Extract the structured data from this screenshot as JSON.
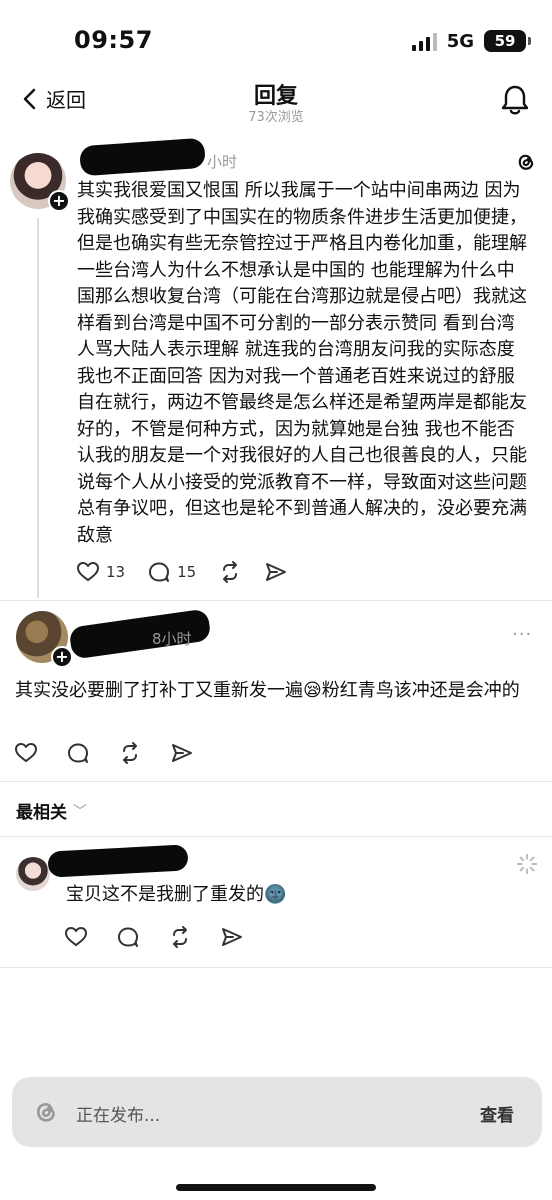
{
  "status": {
    "time": "09:57",
    "network": "5G",
    "battery": "59"
  },
  "nav": {
    "back_label": "返回",
    "title": "回复",
    "views": "73次浏览"
  },
  "post1": {
    "time_suffix": "小时",
    "text": "其实我很爱国又恨国 所以我属于一个站中间串两边 因为我确实感受到了中国实在的物质条件进步生活更加便捷，但是也确实有些无奈管控过于严格且内卷化加重，能理解一些台湾人为什么不想承认是中国的 也能理解为什么中国那么想收复台湾（可能在台湾那边就是侵占吧）我就这样看到台湾是中国不可分割的一部分表示赞同 看到台湾人骂大陆人表示理解 就连我的台湾朋友问我的实际态度我也不正面回答 因为对我一个普通老百姓来说过的舒服自在就行，两边不管最终是怎么样还是希望两岸是都能友好的，不管是何种方式，因为就算她是台独 我也不能否认我的朋友是一个对我很好的人自己也很善良的人，只能说每个人从小接受的党派教育不一样，导致面对这些问题总有争议吧，但这也是轮不到普通人解决的，没必要充满敌意",
    "likes": "13",
    "comments": "15"
  },
  "post2": {
    "time_suffix": "8小时",
    "text": "其实没必要删了打补丁又重新发一遍😪粉红青鸟该冲还是会冲的",
    "more": "···"
  },
  "sort": {
    "label": "最相关"
  },
  "reply": {
    "text": "宝贝这不是我删了重发的🌚"
  },
  "toast": {
    "text": "正在发布...",
    "action": "查看"
  },
  "colors": {
    "accent": "#111111",
    "muted": "#999999",
    "toast_bg": "#e4e4e4"
  }
}
